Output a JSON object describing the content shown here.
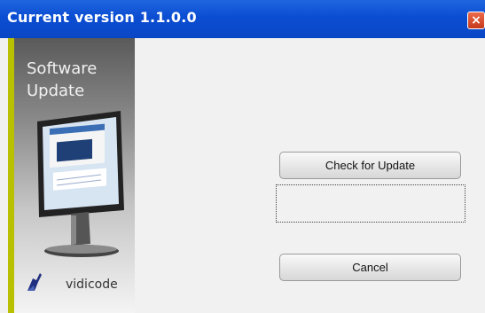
{
  "window": {
    "title": "Current version 1.1.0.0",
    "close_symbol": "×"
  },
  "banner": {
    "title_line1": "Software",
    "title_line2": "Update",
    "brand": "vidicode",
    "accent_color": "#b8c000",
    "image_icon": "monitor-icon",
    "logo_icon": "vidicode-logo-icon"
  },
  "buttons": {
    "check": "Check for Update",
    "cancel": "Cancel"
  }
}
